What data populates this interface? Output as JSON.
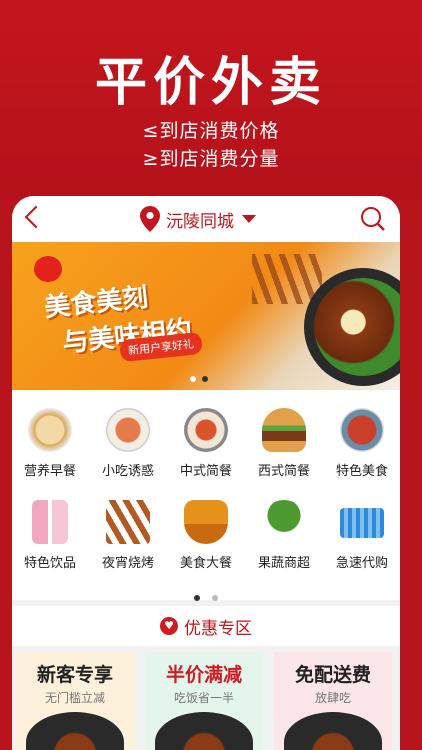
{
  "promo": {
    "title": "平价外卖",
    "line1": "≤到店消费价格",
    "line2": "≥到店消费分量"
  },
  "nav": {
    "city": "沅陵同城",
    "icons": [
      "back-icon",
      "location-pin-icon",
      "dropdown-caret-icon",
      "search-icon"
    ]
  },
  "banner": {
    "headline1": "美食美刻",
    "headline2": "与美味相约",
    "tag": "新用户享好礼",
    "active_slide": 2,
    "slide_count": 2
  },
  "categories": [
    {
      "label": "营养早餐",
      "icon": "dumpling-icon",
      "color": "#f1c27a"
    },
    {
      "label": "小吃诱惑",
      "icon": "snack-bowl-icon",
      "color": "#e57a4a"
    },
    {
      "label": "中式简餐",
      "icon": "rice-dish-icon",
      "color": "#d9532c"
    },
    {
      "label": "西式简餐",
      "icon": "burger-icon",
      "color": "#e0a14a"
    },
    {
      "label": "特色美食",
      "icon": "special-dish-icon",
      "color": "#c9412a"
    },
    {
      "label": "特色饮品",
      "icon": "drink-icon",
      "color": "#f2a7c0"
    },
    {
      "label": "夜宵烧烤",
      "icon": "skewer-icon",
      "color": "#b35a24"
    },
    {
      "label": "美食大餐",
      "icon": "hotpot-icon",
      "color": "#e5921c"
    },
    {
      "label": "果蔬商超",
      "icon": "broccoli-icon",
      "color": "#4d9a2e"
    },
    {
      "label": "急速代购",
      "icon": "basket-icon",
      "color": "#2f8ad8"
    }
  ],
  "category_pager": {
    "active": 1,
    "count": 2
  },
  "deals": {
    "header": "优惠专区",
    "items": [
      {
        "title": "新客专享",
        "subtitle": "无门槛立减",
        "title_color": "#222222",
        "bg": "#fdf1dc"
      },
      {
        "title": "半价满减",
        "subtitle": "吃饭省一半",
        "title_color": "#d11a22",
        "bg": "#e4f6ec"
      },
      {
        "title": "免配送费",
        "subtitle": "放肆吃",
        "title_color": "#222222",
        "bg": "#fbe6ea"
      }
    ]
  },
  "colors": {
    "brand_red": "#c0161e",
    "page_bg": "#f2f2f2"
  }
}
